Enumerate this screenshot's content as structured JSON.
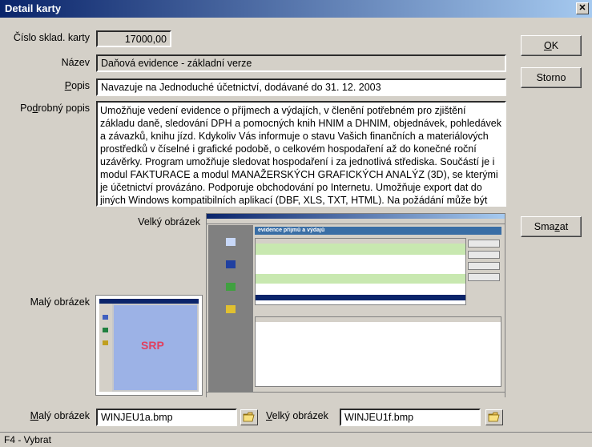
{
  "window": {
    "title": "Detail karty"
  },
  "form": {
    "cislo_label": "Číslo sklad. karty",
    "cislo_value": "17000,00",
    "nazev_label": "Název",
    "nazev_value": "Daňová evidence - základní verze",
    "popis_label_u": "P",
    "popis_label_rest": "opis",
    "popis_value": "Navazuje na Jednoduché účetnictví, dodávané do 31. 12. 2003",
    "podrobny_label_a": "Po",
    "podrobny_label_u": "d",
    "podrobny_label_b": "robný popis",
    "podrobny_value": "Umožňuje vedení evidence o příjmech a výdajích, v členění potřebném pro zjištění základu daně, sledování DPH a pomocných knih HNIM a DHNIM, objednávek, pohledávek a závazků, knihu jízd. Kdykoliv Vás informuje o stavu Vašich finančních a materiálových prostředků v číselné i grafické podobě, o celkovém hospodaření až do konečné roční uzávěrky. Program umožňuje sledovat hospodaření i za jednotlivá střediska. Součástí je i modul FAKTURACE a modul MANAŽERSKÝCH GRAFICKÝCH ANALÝZ (3D), se kterými je účetnictví provázáno. Podporuje obchodování po Internetu. Umožňuje export dat do jiných Windows kompatibilních aplikací (DBF, XLS, TXT, HTML). Na požádání může být propojen",
    "velky_label": "Velký obrázek",
    "maly_label": "Malý obrázek",
    "maly_bottom_label_u": "M",
    "maly_bottom_label_rest": "alý obrázek",
    "maly_file": "WINJEU1a.bmp",
    "velky_bottom_label_u": "V",
    "velky_bottom_label_rest": "elký obrázek",
    "velky_file": "WINJEU1f.bmp"
  },
  "buttons": {
    "ok_u": "O",
    "ok_rest": "K",
    "storno": "Storno",
    "smazat_a": "Sma",
    "smazat_u": "z",
    "smazat_b": "at"
  },
  "preview": {
    "title": "evidence příjmů a výdajů",
    "logo": "SRP"
  },
  "status": {
    "text": "F4 - Vybrat"
  }
}
